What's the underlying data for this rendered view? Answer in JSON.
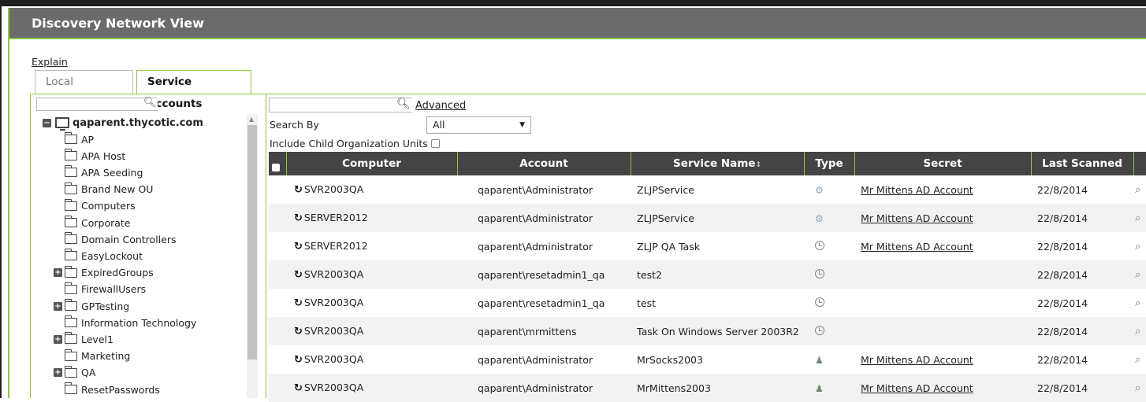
{
  "window": {
    "title": "Discovery Network View"
  },
  "explain_link": "Explain",
  "tabs": [
    {
      "label": "Local Accounts",
      "active": false
    },
    {
      "label": "Service Accounts",
      "active": true
    }
  ],
  "tree": {
    "search_placeholder": "",
    "root": "qaparent.thycotic.com",
    "nodes": [
      {
        "label": "AP",
        "expandable": false
      },
      {
        "label": "APA Host",
        "expandable": false
      },
      {
        "label": "APA Seeding",
        "expandable": false
      },
      {
        "label": "Brand New OU",
        "expandable": false
      },
      {
        "label": "Computers",
        "expandable": false
      },
      {
        "label": "Corporate",
        "expandable": false
      },
      {
        "label": "Domain Controllers",
        "expandable": false
      },
      {
        "label": "EasyLockout",
        "expandable": false
      },
      {
        "label": "ExpiredGroups",
        "expandable": true
      },
      {
        "label": "FirewallUsers",
        "expandable": false
      },
      {
        "label": "GPTesting",
        "expandable": true
      },
      {
        "label": "Information Technology",
        "expandable": false
      },
      {
        "label": "Level1",
        "expandable": true
      },
      {
        "label": "Marketing",
        "expandable": false
      },
      {
        "label": "QA",
        "expandable": true
      },
      {
        "label": "ResetPasswords",
        "expandable": false
      }
    ]
  },
  "search": {
    "value": "",
    "advanced_label": "Advanced",
    "search_by_label": "Search By",
    "search_by_value": "All",
    "include_child_label": "Include Child Organization Units"
  },
  "grid": {
    "columns": [
      "Computer",
      "Account",
      "Service Name",
      "Type",
      "Secret",
      "Last Scanned"
    ],
    "sort_indicator": "↕",
    "rows": [
      {
        "computer": "SVR2003QA",
        "account": "qaparent\\Administrator",
        "service": "ZLJPService",
        "type": "service",
        "secret": "Mr Mittens AD Account",
        "scanned": "22/8/2014"
      },
      {
        "computer": "SERVER2012",
        "account": "qaparent\\Administrator",
        "service": "ZLJPService",
        "type": "service",
        "secret": "Mr Mittens AD Account",
        "scanned": "22/8/2014"
      },
      {
        "computer": "SERVER2012",
        "account": "qaparent\\Administrator",
        "service": "ZLJP QA Task",
        "type": "task",
        "secret": "Mr Mittens AD Account",
        "scanned": "22/8/2014"
      },
      {
        "computer": "SVR2003QA",
        "account": "qaparent\\resetadmin1_qa",
        "service": "test2",
        "type": "task",
        "secret": "",
        "scanned": "22/8/2014"
      },
      {
        "computer": "SVR2003QA",
        "account": "qaparent\\resetadmin1_qa",
        "service": "test",
        "type": "task",
        "secret": "",
        "scanned": "22/8/2014"
      },
      {
        "computer": "SVR2003QA",
        "account": "qaparent\\mrmittens",
        "service": "Task On Windows Server 2003R2",
        "type": "task",
        "secret": "",
        "scanned": "22/8/2014"
      },
      {
        "computer": "SVR2003QA",
        "account": "qaparent\\Administrator",
        "service": "MrSocks2003",
        "type": "apppool",
        "secret": "Mr Mittens AD Account",
        "scanned": "22/8/2014"
      },
      {
        "computer": "SVR2003QA",
        "account": "qaparent\\Administrator",
        "service": "MrMittens2003",
        "type": "apppool",
        "secret": "Mr Mittens AD Account",
        "scanned": "22/8/2014"
      }
    ]
  },
  "icons": {
    "type_service": "gears-icon",
    "type_task": "clock-icon",
    "type_apppool": "user-icon",
    "row_action": "view-icon"
  },
  "colors": {
    "accent": "#8dc63f",
    "titlebar": "#6b6b6b",
    "header": "#444444"
  }
}
